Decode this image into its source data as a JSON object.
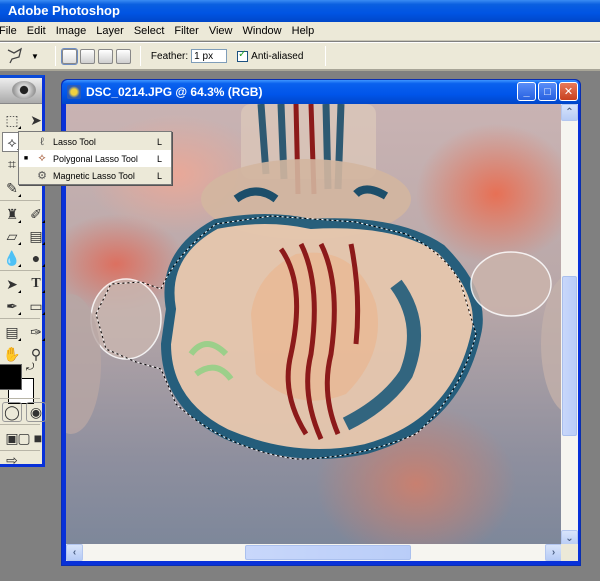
{
  "app": {
    "title": "Adobe Photoshop"
  },
  "menubar": {
    "items": [
      "File",
      "Edit",
      "Image",
      "Layer",
      "Select",
      "Filter",
      "View",
      "Window",
      "Help"
    ]
  },
  "options_bar": {
    "current_tool_icon": "polygonal-lasso-icon",
    "selection_modes": [
      "new-selection",
      "add-to-selection",
      "subtract-from-selection",
      "intersect-with-selection"
    ],
    "active_selection_mode": "new-selection",
    "feather_label": "Feather:",
    "feather_value": "1 px",
    "anti_aliased_label": "Anti-aliased",
    "anti_aliased_checked": true
  },
  "toolbox": {
    "tools": [
      "rectangular-marquee",
      "move",
      "polygonal-lasso",
      "magic-wand",
      "crop",
      "slice",
      "healing-brush",
      "brush",
      "clone-stamp",
      "history-brush",
      "eraser",
      "gradient",
      "blur",
      "dodge",
      "path-selection",
      "type",
      "pen",
      "shape",
      "notes",
      "eyedropper",
      "hand",
      "zoom"
    ],
    "foreground_color": "#000000",
    "background_color": "#ffffff"
  },
  "document": {
    "title": "DSC_0214.JPG @ 64.3% (RGB)",
    "zoom": "64.3%",
    "color_mode": "RGB",
    "filename": "DSC_0214.JPG"
  },
  "flyout": {
    "items": [
      {
        "label": "Lasso Tool",
        "shortcut": "L",
        "icon": "lasso-icon",
        "selected": false
      },
      {
        "label": "Polygonal Lasso Tool",
        "shortcut": "L",
        "icon": "polygonal-lasso-icon",
        "selected": true
      },
      {
        "label": "Magnetic Lasso Tool",
        "shortcut": "L",
        "icon": "magnetic-lasso-icon",
        "selected": false
      }
    ],
    "bullet": "■"
  },
  "window_buttons": {
    "minimize": "_",
    "maximize": "□",
    "close": "✕"
  },
  "scrollbars": {
    "vertical_position_fraction": 0.38,
    "vertical_visible_fraction": 0.39,
    "horizontal_position_fraction": 0.35,
    "horizontal_visible_fraction": 0.36,
    "arrows": {
      "up": "⌃",
      "down": "⌄",
      "left": "‹",
      "right": "›"
    }
  }
}
